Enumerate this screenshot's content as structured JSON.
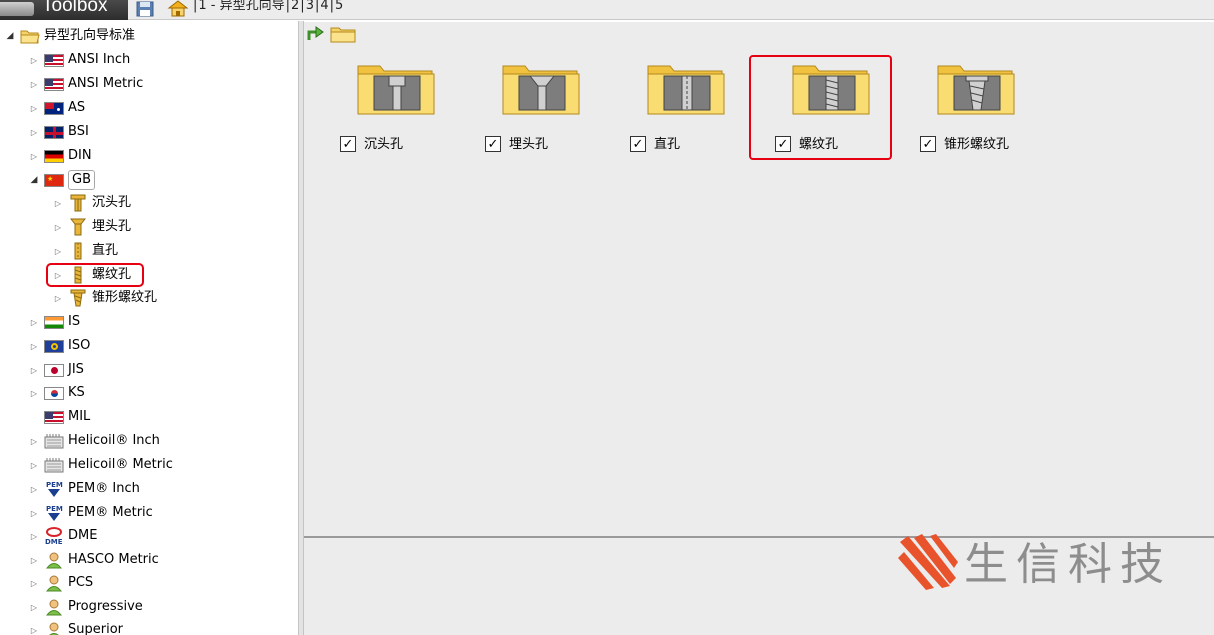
{
  "app": {
    "title": "Toolbox"
  },
  "breadcrumb": {
    "items": [
      "1 - 异型孔向导",
      "2",
      "3",
      "4",
      "5"
    ],
    "separator": "|"
  },
  "tree": {
    "root_label": "异型孔向导标准",
    "nodes": [
      {
        "label": "ANSI Inch",
        "icon": "usa-flag-icon"
      },
      {
        "label": "ANSI Metric",
        "icon": "usa-flag-icon"
      },
      {
        "label": "AS",
        "icon": "australia-flag-icon"
      },
      {
        "label": "BSI",
        "icon": "uk-flag-icon"
      },
      {
        "label": "DIN",
        "icon": "germany-flag-icon"
      },
      {
        "label": "GB",
        "icon": "china-flag-icon",
        "expanded": true,
        "children": [
          {
            "label": "沉头孔",
            "icon": "counterbore-hole-icon"
          },
          {
            "label": "埋头孔",
            "icon": "countersink-hole-icon"
          },
          {
            "label": "直孔",
            "icon": "straight-hole-icon"
          },
          {
            "label": "螺纹孔",
            "icon": "tapped-hole-icon",
            "highlighted": true
          },
          {
            "label": "锥形螺纹孔",
            "icon": "tapered-tapped-hole-icon"
          }
        ]
      },
      {
        "label": "IS",
        "icon": "india-flag-icon"
      },
      {
        "label": "ISO",
        "icon": "iso-flag-icon"
      },
      {
        "label": "JIS",
        "icon": "japan-flag-icon"
      },
      {
        "label": "KS",
        "icon": "korea-flag-icon"
      },
      {
        "label": "MIL",
        "icon": "usa-flag-icon"
      },
      {
        "label": "Helicoil® Inch",
        "icon": "helicoil-icon"
      },
      {
        "label": "Helicoil® Metric",
        "icon": "helicoil-icon"
      },
      {
        "label": "PEM® Inch",
        "icon": "pem-icon"
      },
      {
        "label": "PEM® Metric",
        "icon": "pem-icon"
      },
      {
        "label": "DME",
        "icon": "dme-icon"
      },
      {
        "label": "HASCO Metric",
        "icon": "user-icon"
      },
      {
        "label": "PCS",
        "icon": "user-icon"
      },
      {
        "label": "Progressive",
        "icon": "user-icon"
      },
      {
        "label": "Superior",
        "icon": "user-icon"
      }
    ]
  },
  "content": {
    "folders": [
      {
        "label": "沉头孔",
        "checked": true,
        "icon": "counterbore-folder-icon"
      },
      {
        "label": "埋头孔",
        "checked": true,
        "icon": "countersink-folder-icon"
      },
      {
        "label": "直孔",
        "checked": true,
        "icon": "straight-hole-folder-icon"
      },
      {
        "label": "螺纹孔",
        "checked": true,
        "icon": "tapped-hole-folder-icon",
        "highlighted": true
      },
      {
        "label": "锥形螺纹孔",
        "checked": true,
        "icon": "tapered-tapped-folder-icon"
      }
    ],
    "check_glyph": "✓"
  },
  "watermark": {
    "text": "生信科技"
  },
  "colors": {
    "highlight": "#e60012",
    "folder_yellow": "#f5c842",
    "panel_bg": "#ececec"
  }
}
